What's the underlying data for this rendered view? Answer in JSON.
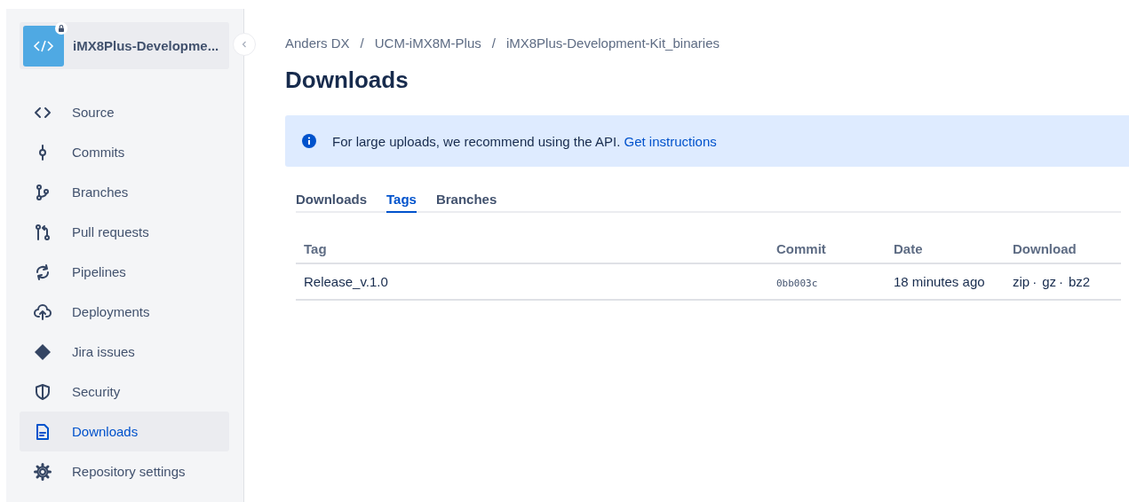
{
  "sidebar": {
    "repo": {
      "name": "iMX8Plus-Developme...",
      "private": true
    },
    "items": [
      {
        "label": "Source",
        "selected": false
      },
      {
        "label": "Commits",
        "selected": false
      },
      {
        "label": "Branches",
        "selected": false
      },
      {
        "label": "Pull requests",
        "selected": false
      },
      {
        "label": "Pipelines",
        "selected": false
      },
      {
        "label": "Deployments",
        "selected": false
      },
      {
        "label": "Jira issues",
        "selected": false
      },
      {
        "label": "Security",
        "selected": false
      },
      {
        "label": "Downloads",
        "selected": true
      },
      {
        "label": "Repository settings",
        "selected": false
      }
    ]
  },
  "breadcrumb": [
    "Anders DX",
    "UCM-iMX8M-Plus",
    "iMX8Plus-Development-Kit_binaries"
  ],
  "breadcrumb_separator": "/",
  "title": "Downloads",
  "banner": {
    "text": "For large uploads, we recommend using the API.",
    "link": "Get instructions"
  },
  "tabs": [
    {
      "label": "Downloads",
      "selected": false
    },
    {
      "label": "Tags",
      "selected": true
    },
    {
      "label": "Branches",
      "selected": false
    }
  ],
  "table": {
    "columns": [
      "Tag",
      "Commit",
      "Date",
      "Download"
    ],
    "rows": [
      {
        "tag": "Release_v.1.0",
        "commit": "0bb003c",
        "date": "18 minutes ago",
        "download": [
          {
            "kind": "link",
            "text": "zip"
          },
          {
            "kind": "separator",
            "text": "·"
          },
          {
            "kind": "link",
            "text": "gz"
          },
          {
            "kind": "separator",
            "text": "·"
          },
          {
            "kind": "link",
            "text": "bz2"
          }
        ]
      }
    ]
  }
}
